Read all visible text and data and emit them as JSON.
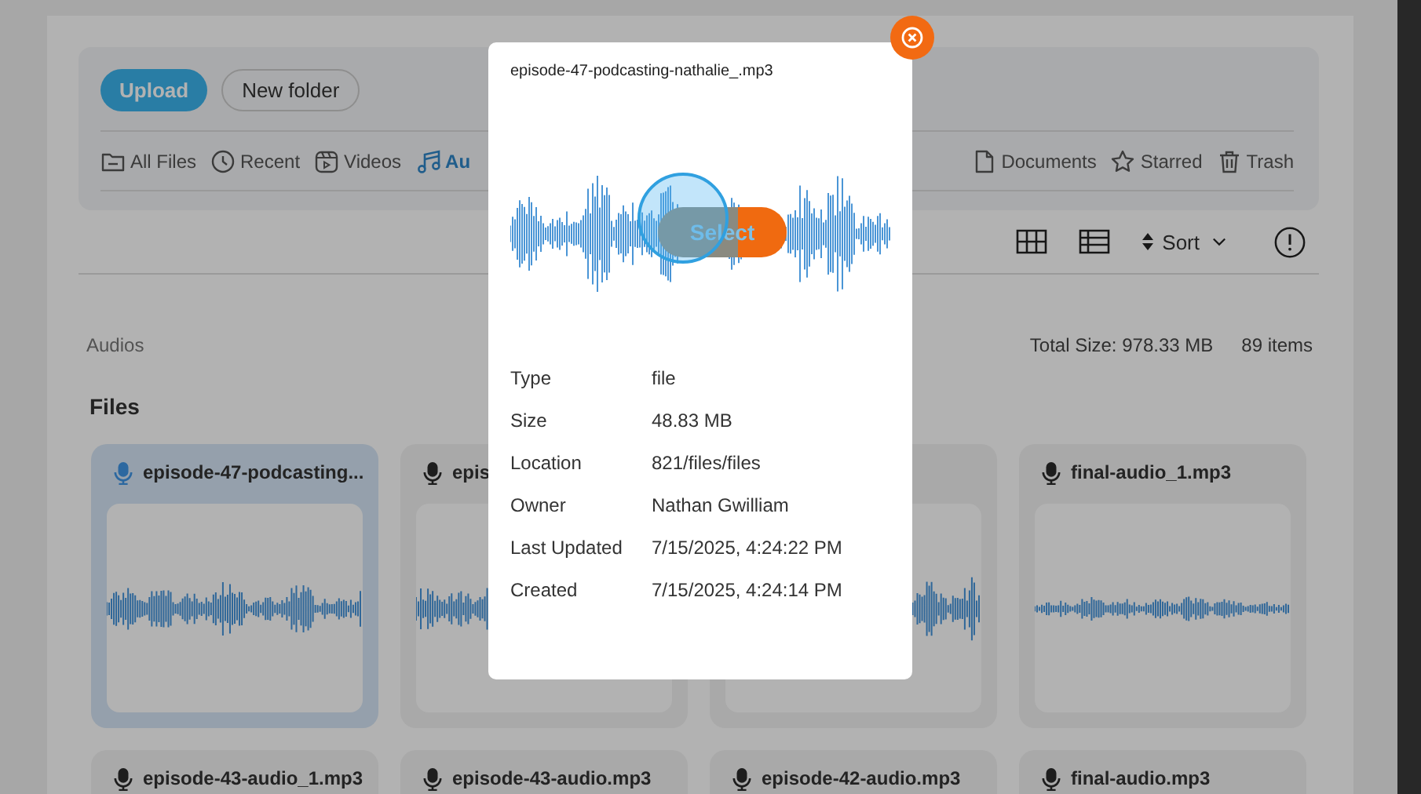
{
  "toolbar": {
    "buttons": [
      {
        "label": "Upload",
        "kind": "primary"
      },
      {
        "label": "New folder",
        "kind": "secondary"
      }
    ]
  },
  "nav": [
    {
      "label": "All Files",
      "kind": "folder",
      "selected": false
    },
    {
      "label": "Recent",
      "kind": "recent",
      "selected": false
    },
    {
      "label": "Videos",
      "kind": "videos",
      "selected": false
    },
    {
      "label": "Au",
      "kind": "audios",
      "selected": true
    },
    {
      "label": "Documents",
      "kind": "documents",
      "selected": false
    },
    {
      "label": "Starred",
      "kind": "starred",
      "selected": false
    },
    {
      "label": "Trash",
      "kind": "trash",
      "selected": false
    }
  ],
  "view_controls": {
    "sort_label": "Sort"
  },
  "section": {
    "breadcrumb": "Audios",
    "total_size": "Total Size: 978.33 MB",
    "count": "89 items",
    "heading": "Files"
  },
  "files": [
    {
      "name": "episode-47-podcasting...",
      "selected": true
    },
    {
      "name": "epis",
      "selected": false
    },
    {
      "selected": false
    },
    {
      "name": "final-audio_1.mp3",
      "selected": false
    },
    {
      "name": "episode-43-audio_1.mp3",
      "selected": false
    },
    {
      "name": "episode-43-audio.mp3",
      "selected": false
    },
    {
      "name": "episode-42-audio.mp3",
      "selected": false
    },
    {
      "name": "final-audio.mp3",
      "selected": false
    }
  ],
  "preview": {
    "title": "episode-47-podcasting-nathalie_.mp3",
    "select_label": "Select",
    "details": [
      {
        "label": "Type",
        "value": "file"
      },
      {
        "label": "Size",
        "value": "48.83 MB"
      },
      {
        "label": "Location",
        "value": "821/files/files"
      },
      {
        "label": "Owner",
        "value": "Nathan Gwilliam"
      },
      {
        "label": "Last Updated",
        "value": "7/15/2025, 4:24:22 PM"
      },
      {
        "label": "Created",
        "value": "7/15/2025, 4:24:14 PM"
      }
    ]
  }
}
